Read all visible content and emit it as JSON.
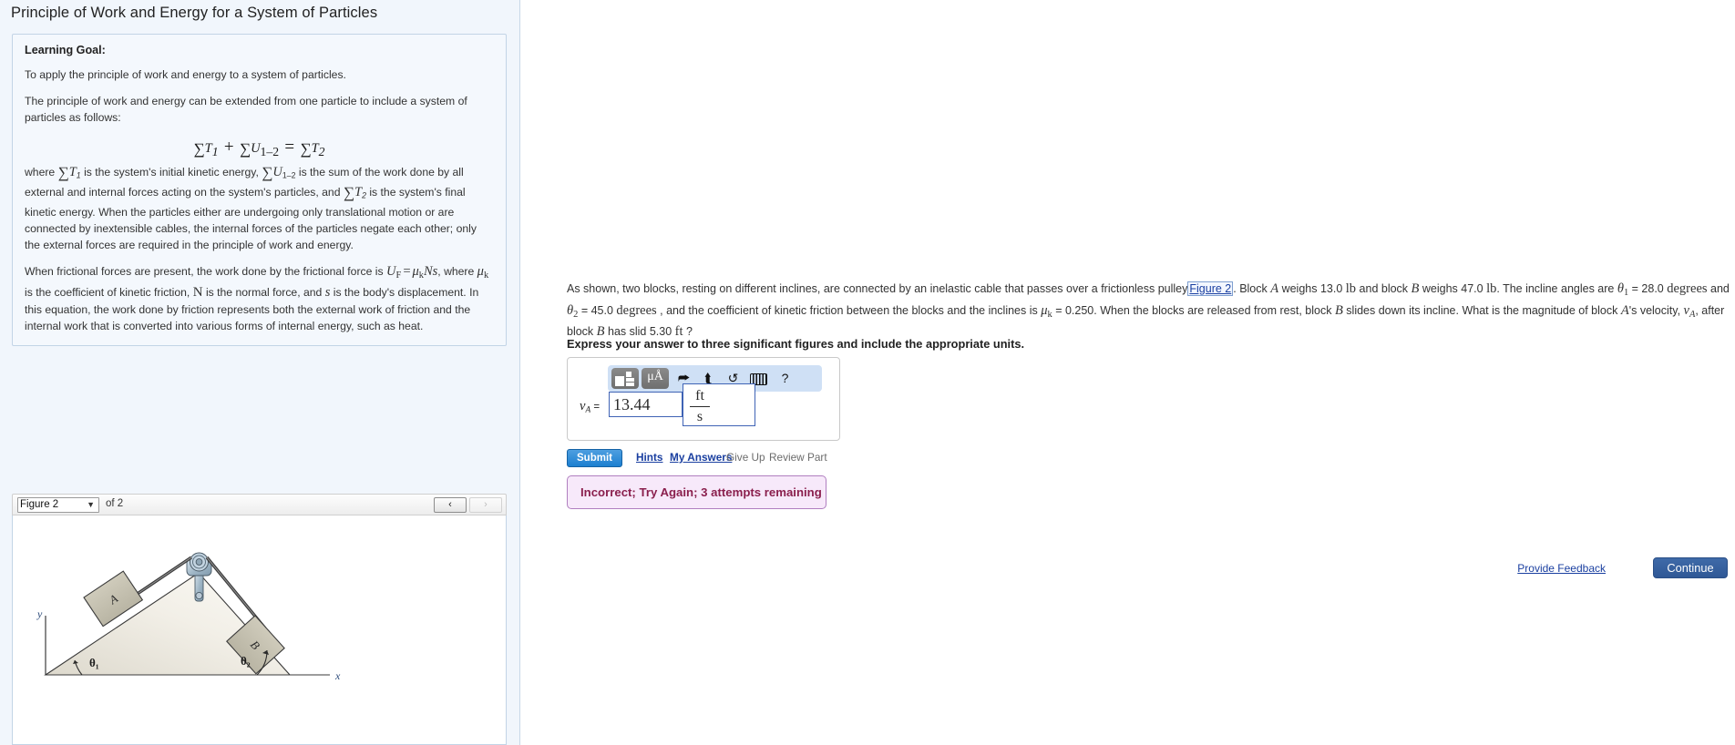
{
  "tutorial": {
    "title": "Principle of Work and Energy for a System of Particles",
    "learning_goal_heading": "Learning Goal:",
    "goal_text": "To apply the principle of work and energy to a system of particles.",
    "para2_lead": "The principle of work and energy can be extended from one particle to include a system of particles as follows:",
    "equation_main": "∑T₁ + ∑U₁₋₂ = ∑T₂",
    "para2_body_1": "where ",
    "para2_body_2": " is the system's initial kinetic energy, ",
    "para2_body_3": " is the sum of the work done by all external and internal forces acting on the system's particles, and ",
    "para2_body_4": " is the system's final kinetic energy. When the particles either are undergoing only translational motion or are connected by inextensible cables, the internal forces of the particles negate each other; only the external forces are required in the principle of work and energy.",
    "para3_1": "When frictional forces are present, the work done by the frictional force is ",
    "para3_eq": "Uᶠ = μₖNs",
    "para3_2": ", where ",
    "para3_sym_mu": "μₖ",
    "para3_3": " is the coefficient of kinetic friction, ",
    "para3_sym_N": "N",
    "para3_4": " is the normal force, and ",
    "para3_sym_s": "s",
    "para3_5": " is the body's displacement. In this equation, the work done by friction represents both the external work of friction and the internal work that is converted into various forms of internal energy, such as heat."
  },
  "figure_panel": {
    "selected_figure": "Figure 2",
    "of_label": "of 2",
    "prev_glyph": "‹",
    "next_glyph": "›",
    "caret_glyph": "▼",
    "diagram": {
      "block_a_label": "A",
      "block_b_label": "B",
      "angle1_label": "θ₁",
      "angle2_label": "θ₂",
      "axis_x": "x",
      "axis_y": "y"
    }
  },
  "problem": {
    "text_1": "As shown, two blocks, resting on different inclines, are connected by an inelastic cable that passes over a frictionless pulley",
    "figure_link": "Figure 2",
    "text_2": ". Block ",
    "block_a": "A",
    "text_3": " weighs 13.0 ",
    "unit_lb_1": "lb",
    "text_4": " and block ",
    "block_b": "B",
    "text_5": " weighs 47.0 ",
    "unit_lb_2": "lb",
    "text_6": ". The incline angles are ",
    "theta1": "θ₁",
    "text_7": " = 28.0 ",
    "deg_1": "degrees",
    "text_8": " and ",
    "theta2": "θ₂",
    "text_9": " = 45.0 ",
    "deg_2": "degrees",
    "text_10": " , and the coefficient of kinetic friction between the blocks and the inclines is ",
    "mu_k": "μₖ",
    "text_11": " = 0.250. When the blocks are released from rest, block ",
    "block_b2": "B",
    "text_12": " slides down its incline. What is the magnitude of block ",
    "block_a2": "A",
    "text_13": "'s velocity, ",
    "v_a": "vₐ",
    "text_14": ", after block ",
    "block_b3": "B",
    "text_15": " has slid 5.30 ",
    "unit_ft": "ft",
    "text_16": " ?",
    "instruction": "Express your answer to three significant figures and include the appropriate units."
  },
  "answer_widget": {
    "toolbar": {
      "template_icon": "math-template-icon",
      "unit_icon_label": "μÅ",
      "undo_glyph": "⮫",
      "redo_glyph": "⮬",
      "reset_glyph": "↺",
      "keyboard_icon": "keyboard-icon",
      "help_glyph": "?"
    },
    "variable_label": "v",
    "variable_sub": "A",
    "equals": "=",
    "value": "13.44",
    "placeholder": "",
    "unit_numerator": "ft",
    "unit_denominator": "s"
  },
  "actions": {
    "submit_label": "Submit",
    "hints_label": "Hints",
    "my_answers_label": "My Answers",
    "give_up_label": "Give Up",
    "review_part_label": "Review Part"
  },
  "feedback": {
    "message": "Incorrect; Try Again; 3 attempts remaining"
  },
  "footer": {
    "provide_feedback_label": "Provide Feedback",
    "continue_label": "Continue"
  },
  "colors": {
    "panel_bg": "#f1f6fc",
    "submit_blue": "#1c7fd0",
    "continue_blue": "#2f5896",
    "link_blue": "#1a3fa0",
    "feedback_bg": "#f7e9fa",
    "feedback_text": "#8a1f4d",
    "toolbar_bg": "#cfe0f5"
  }
}
